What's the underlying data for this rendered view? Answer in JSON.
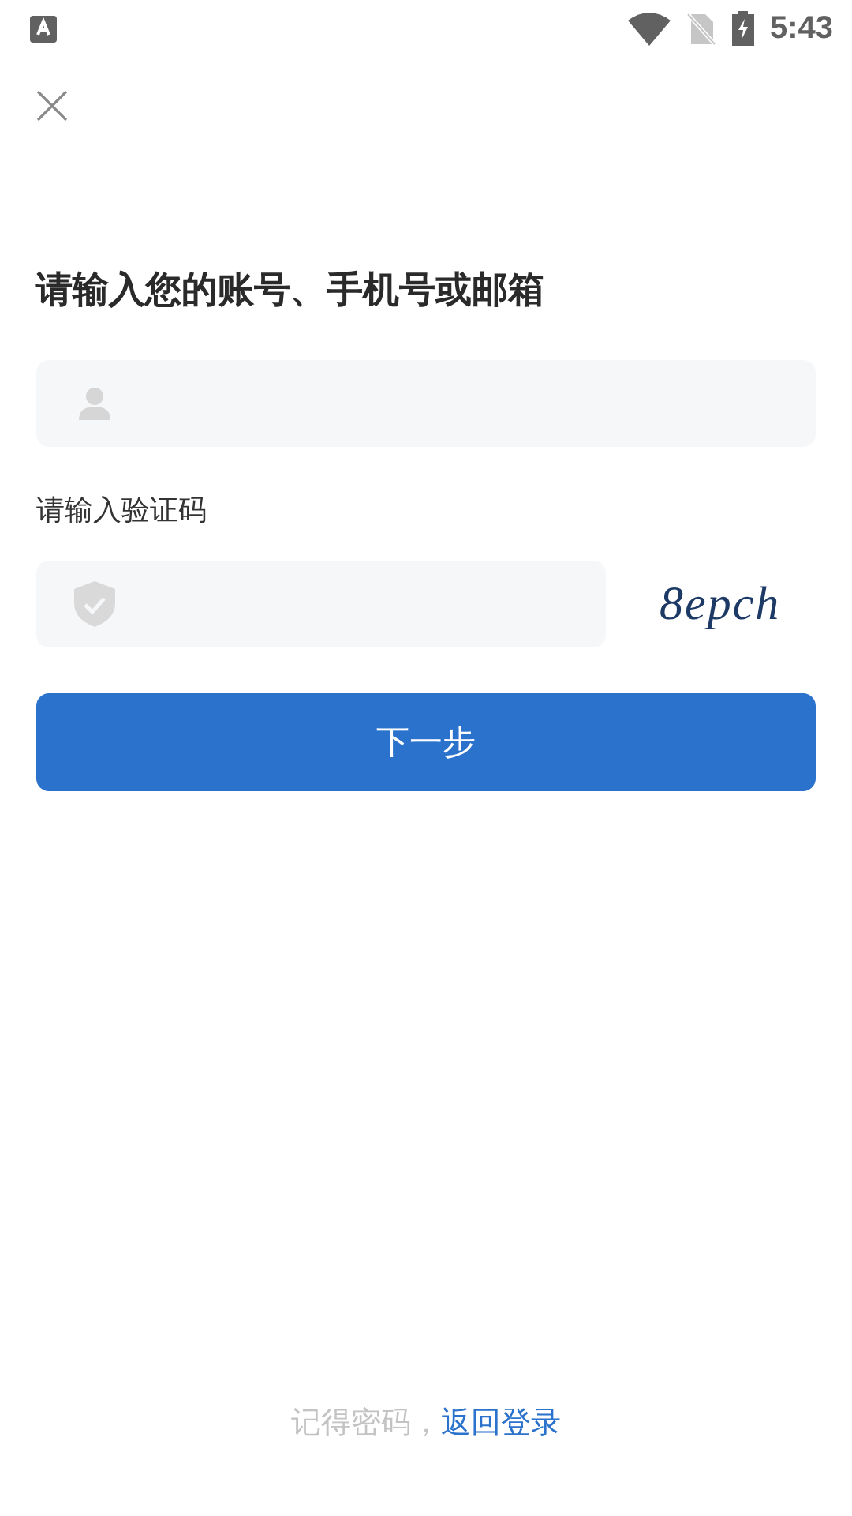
{
  "status_bar": {
    "time": "5:43"
  },
  "title": "请输入您的账号、手机号或邮箱",
  "captcha_label": "请输入验证码",
  "captcha_image": {
    "text": "8epch"
  },
  "next_button": "下一步",
  "footer": {
    "text": "记得密码，",
    "link": "返回登录"
  }
}
